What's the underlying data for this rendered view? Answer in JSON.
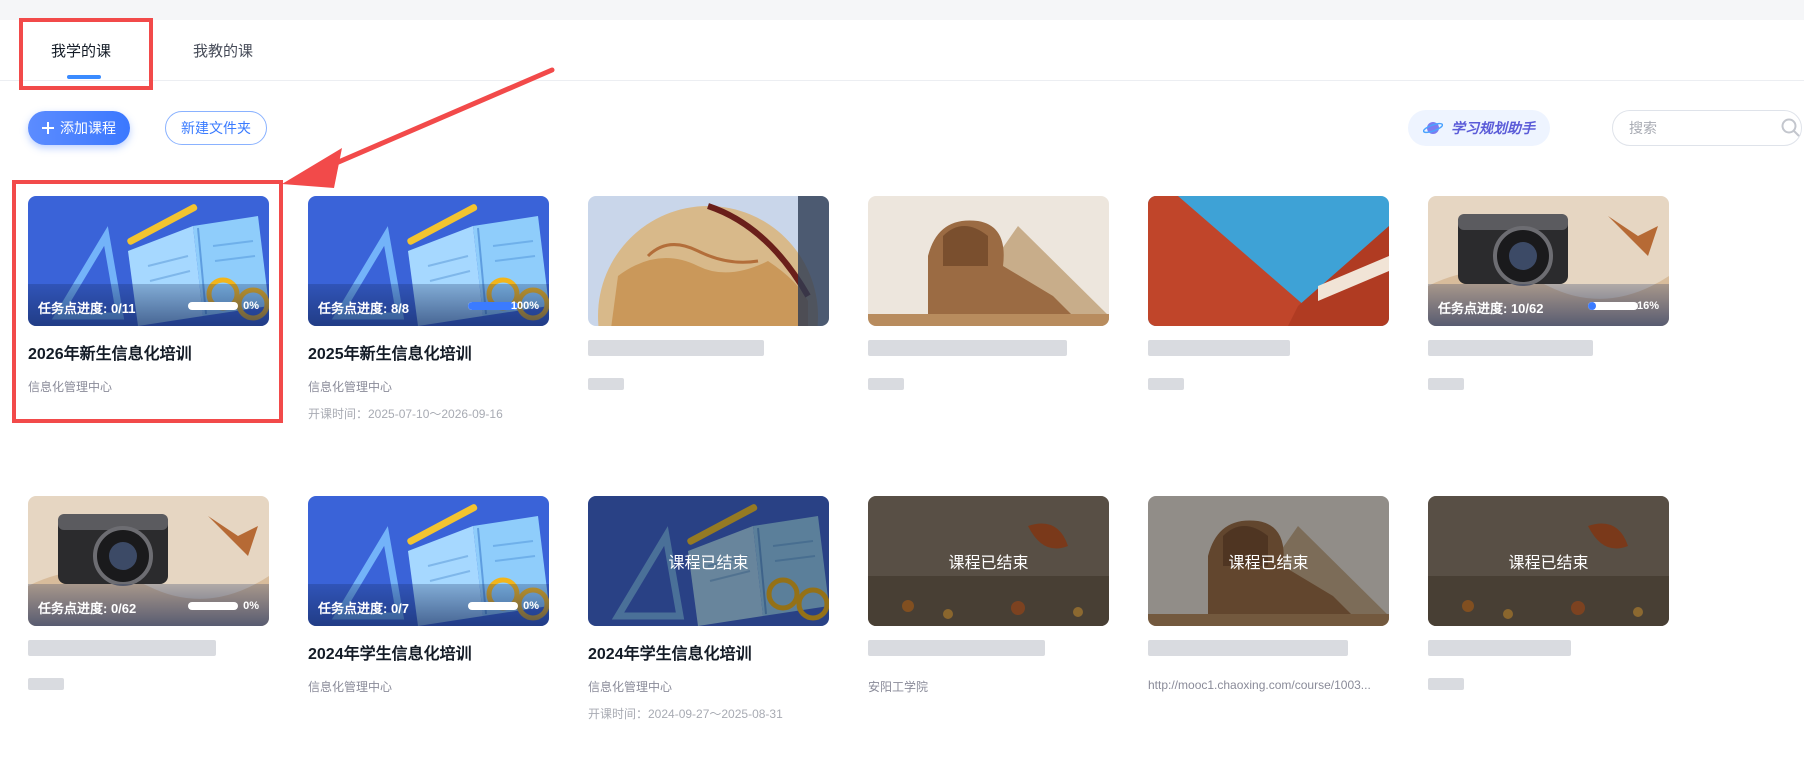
{
  "tabs": [
    {
      "label": "我学的课",
      "active": true
    },
    {
      "label": "我教的课",
      "active": false
    }
  ],
  "toolbar": {
    "add_course": "添加课程",
    "new_folder": "新建文件夹",
    "plan_assistant": "学习规划助手",
    "search_placeholder": "搜索"
  },
  "colors": {
    "accent": "#3a7bff",
    "highlight": "#f24a4a"
  },
  "courses": [
    {
      "title": "2026年新生信息化培训",
      "org": "信息化管理中心",
      "time": "",
      "progress_label": "任务点进度: 0/11",
      "progress_pct": "0%",
      "progress": 0,
      "theme": "book",
      "ended": false,
      "ended_label": ""
    },
    {
      "title": "2025年新生信息化培训",
      "org": "信息化管理中心",
      "time": "开课时间：2025-07-10～2026-09-16",
      "progress_label": "任务点进度: 8/8",
      "progress_pct": "100%",
      "progress": 100,
      "theme": "book",
      "ended": false,
      "ended_label": ""
    },
    {
      "title": "",
      "org": "",
      "time": "",
      "progress_label": "",
      "progress_pct": "",
      "progress": null,
      "theme": "globe",
      "ended": false,
      "ended_label": ""
    },
    {
      "title": "",
      "org": "",
      "time": "",
      "progress_label": "",
      "progress_pct": "",
      "progress": null,
      "theme": "sphinx",
      "ended": false,
      "ended_label": ""
    },
    {
      "title": "",
      "org": "",
      "time": "",
      "progress_label": "",
      "progress_pct": "",
      "progress": null,
      "theme": "building",
      "ended": false,
      "ended_label": ""
    },
    {
      "title": "",
      "org": "",
      "time": "",
      "progress_label": "任务点进度: 10/62",
      "progress_pct": "16%",
      "progress": 16,
      "theme": "camera",
      "ended": false,
      "ended_label": ""
    },
    {
      "title": "",
      "org": "",
      "time": "",
      "progress_label": "任务点进度: 0/62",
      "progress_pct": "0%",
      "progress": 0,
      "theme": "camera",
      "ended": false,
      "ended_label": ""
    },
    {
      "title": "2024年学生信息化培训",
      "org": "信息化管理中心",
      "time": "",
      "progress_label": "任务点进度: 0/7",
      "progress_pct": "0%",
      "progress": 0,
      "theme": "book",
      "ended": false,
      "ended_label": ""
    },
    {
      "title": "2024年学生信息化培训",
      "org": "信息化管理中心",
      "time": "开课时间：2024-09-27～2025-08-31",
      "progress_label": "",
      "progress_pct": "",
      "progress": null,
      "theme": "book",
      "ended": true,
      "ended_label": "课程已结束"
    },
    {
      "title": "",
      "org": "安阳工学院",
      "time": "",
      "progress_label": "",
      "progress_pct": "",
      "progress": null,
      "theme": "leaf",
      "ended": true,
      "ended_label": "课程已结束"
    },
    {
      "title": "",
      "org": "http://mooc1.chaoxing.com/course/1003...",
      "time": "",
      "progress_label": "",
      "progress_pct": "",
      "progress": null,
      "theme": "sphinx",
      "ended": true,
      "ended_label": "课程已结束"
    },
    {
      "title": "",
      "org": "",
      "time": "",
      "progress_label": "",
      "progress_pct": "",
      "progress": null,
      "theme": "leaf",
      "ended": true,
      "ended_label": "课程已结束"
    }
  ]
}
